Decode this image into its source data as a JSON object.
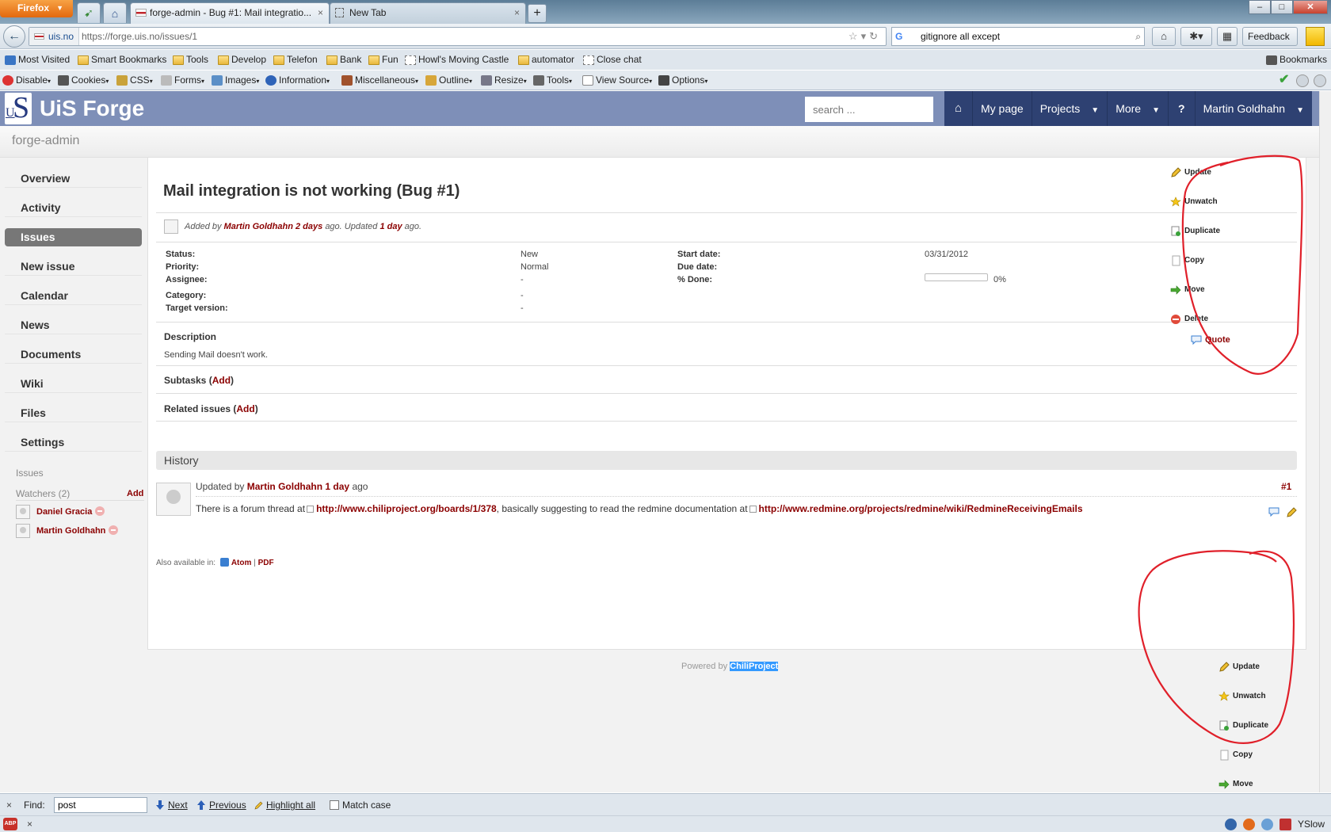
{
  "browser": {
    "menu_button": "Firefox",
    "tabs": [
      {
        "title": "forge-admin - Bug #1: Mail integratio...",
        "active": true
      },
      {
        "title": "New Tab",
        "active": false
      }
    ],
    "url": {
      "site": "uis.no",
      "path": "https://forge.uis.no/issues/1"
    },
    "search_value": "gitignore all except",
    "feedback_label": "Feedback",
    "bookmarks": [
      "Most Visited",
      "Smart Bookmarks",
      "Tools",
      "Develop",
      "Telefon",
      "Bank",
      "Fun",
      "Howl's Moving Castle",
      "automator",
      "Close chat"
    ],
    "bookmarks_menu": "Bookmarks",
    "webdev": [
      "Disable",
      "Cookies",
      "CSS",
      "Forms",
      "Images",
      "Information",
      "Miscellaneous",
      "Outline",
      "Resize",
      "Tools",
      "View Source",
      "Options"
    ],
    "find": {
      "close": "×",
      "label": "Find:",
      "value": "post",
      "next": "Next",
      "previous": "Previous",
      "highlight": "Highlight all",
      "match_case": "Match case"
    },
    "status": {
      "close": "×",
      "abp": "ABP",
      "yslow": "YSlow"
    }
  },
  "site": {
    "title": "UiS Forge",
    "search_placeholder": "search ...",
    "menu": {
      "my_page": "My page",
      "projects": "Projects",
      "more": "More",
      "help": "?",
      "user": "Martin Goldhahn"
    },
    "project_name": "forge-admin"
  },
  "sidebar": {
    "items": [
      "Overview",
      "Activity",
      "Issues",
      "New issue",
      "Calendar",
      "News",
      "Documents",
      "Wiki",
      "Files",
      "Settings"
    ],
    "selected": "Issues",
    "issues_label": "Issues",
    "watchers_label": "Watchers (2)",
    "add_label": "Add",
    "watchers": [
      "Daniel Gracia",
      "Martin Goldhahn"
    ]
  },
  "issue": {
    "title": "Mail integration is not working (Bug #1)",
    "author": {
      "added_by": "Added by",
      "name": "Martin Goldhahn",
      "added_ago": "2 days",
      "ago_updated": "ago. Updated",
      "updated_ago": "1 day",
      "ago_end": "ago."
    },
    "attributes_left": [
      {
        "label": "Status:",
        "value": "New"
      },
      {
        "label": "Priority:",
        "value": "Normal"
      },
      {
        "label": "Assignee:",
        "value": "-"
      },
      {
        "label": "Category:",
        "value": "-"
      },
      {
        "label": "Target version:",
        "value": "-"
      }
    ],
    "attributes_right": [
      {
        "label": "Start date:",
        "value": "03/31/2012"
      },
      {
        "label": "Due date:",
        "value": ""
      },
      {
        "label": "% Done:",
        "value": "0%"
      }
    ],
    "percent_done": 0,
    "description_label": "Description",
    "description": "Sending Mail doesn't work.",
    "subtasks_label": "Subtasks",
    "related_label": "Related issues",
    "add_link": "Add",
    "quote_label": "Quote",
    "actions": [
      "Update",
      "Unwatch",
      "Duplicate",
      "Copy",
      "Move",
      "Delete"
    ]
  },
  "history": {
    "title": "History",
    "journal": {
      "updated_by": "Updated by",
      "author": "Martin Goldhahn",
      "ago": "1 day",
      "ago_suffix": "ago",
      "number": "#1",
      "text_1": "There is a forum thread at",
      "link_1": "http://www.chiliproject.org/boards/1/378",
      "text_2": ", basically suggesting to read the redmine documentation at",
      "link_2": "http://www.redmine.org/projects/redmine/wiki/RedmineReceivingEmails"
    }
  },
  "footer": {
    "also_available": "Also available in:",
    "atom": "Atom",
    "sep": "|",
    "pdf": "PDF",
    "powered_by": "Powered by",
    "chili": "ChiliProject"
  },
  "annotation_color": "#e0202a"
}
